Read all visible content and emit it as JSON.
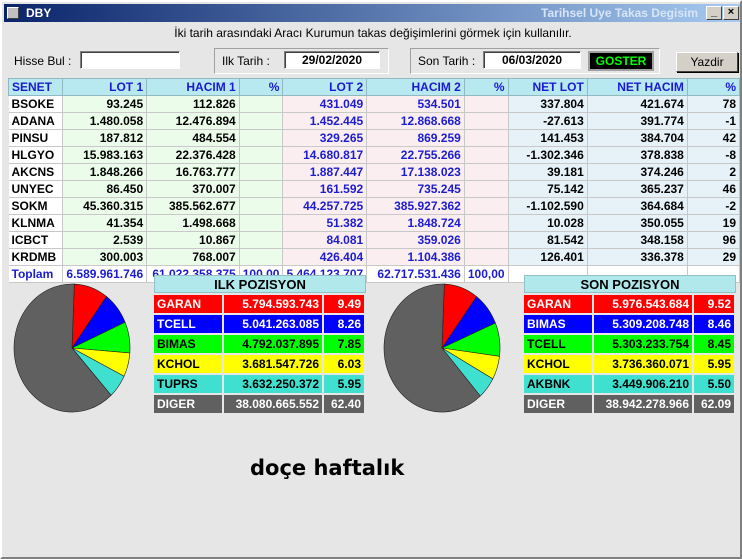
{
  "window": {
    "title": "DBY",
    "title_right": "Tarihsel Uye Takas Degisim",
    "min_label": "_",
    "max_label": "□",
    "close_label": "×"
  },
  "info": "İki tarih arasındaki  Aracı Kurumun takas değişimlerini görmek için kullanılır.",
  "toolbar": {
    "hisse_label": "Hisse Bul :",
    "hisse_value": "",
    "ilk_label": "Ilk Tarih :",
    "ilk_value": "29/02/2020",
    "son_label": "Son Tarih :",
    "son_value": "06/03/2020",
    "goster_label": "GOSTER",
    "yazdir_label": "Yazdir"
  },
  "table": {
    "headers": [
      "SENET",
      "LOT 1",
      "HACIM 1",
      "%",
      "LOT 2",
      "HACIM 2",
      "%",
      "NET LOT",
      "NET HACIM",
      "%"
    ],
    "rows": [
      [
        "BSOKE",
        "93.245",
        "112.826",
        "",
        "431.049",
        "534.501",
        "",
        "337.804",
        "421.674",
        "78"
      ],
      [
        "ADANA",
        "1.480.058",
        "12.476.894",
        "",
        "1.452.445",
        "12.868.668",
        "",
        "-27.613",
        "391.774",
        "-1"
      ],
      [
        "PINSU",
        "187.812",
        "484.554",
        "",
        "329.265",
        "869.259",
        "",
        "141.453",
        "384.704",
        "42"
      ],
      [
        "HLGYO",
        "15.983.163",
        "22.376.428",
        "",
        "14.680.817",
        "22.755.266",
        "",
        "-1.302.346",
        "378.838",
        "-8"
      ],
      [
        "AKCNS",
        "1.848.266",
        "16.763.777",
        "",
        "1.887.447",
        "17.138.023",
        "",
        "39.181",
        "374.246",
        "2"
      ],
      [
        "UNYEC",
        "86.450",
        "370.007",
        "",
        "161.592",
        "735.245",
        "",
        "75.142",
        "365.237",
        "46"
      ],
      [
        "SOKM",
        "45.360.315",
        "385.562.677",
        "",
        "44.257.725",
        "385.927.362",
        "",
        "-1.102.590",
        "364.684",
        "-2"
      ],
      [
        "KLNMA",
        "41.354",
        "1.498.668",
        "",
        "51.382",
        "1.848.724",
        "",
        "10.028",
        "350.055",
        "19"
      ],
      [
        "ICBCT",
        "2.539",
        "10.867",
        "",
        "84.081",
        "359.026",
        "",
        "81.542",
        "348.158",
        "96"
      ],
      [
        "KRDMB",
        "300.003",
        "768.007",
        "",
        "426.404",
        "1.104.386",
        "",
        "126.401",
        "336.378",
        "29"
      ]
    ],
    "total": [
      "Toplam",
      "6.589.961.746",
      "61.022.358.375",
      "100,00",
      "5.464.123.707",
      "62.717.531.436",
      "100,00",
      "",
      "",
      ""
    ]
  },
  "ilk": {
    "title": "ILK POZISYON",
    "items": [
      {
        "name": "GARAN",
        "value": "5.794.593.743",
        "pct": "9.49",
        "pct_num": 9.49,
        "bg": "#ff0000",
        "fg": "#ffffff"
      },
      {
        "name": "TCELL",
        "value": "5.041.263.085",
        "pct": "8.26",
        "pct_num": 8.26,
        "bg": "#0000ff",
        "fg": "#ffffff"
      },
      {
        "name": "BIMAS",
        "value": "4.792.037.895",
        "pct": "7.85",
        "pct_num": 7.85,
        "bg": "#00ff00",
        "fg": "#000000"
      },
      {
        "name": "KCHOL",
        "value": "3.681.547.726",
        "pct": "6.03",
        "pct_num": 6.03,
        "bg": "#ffff00",
        "fg": "#000000"
      },
      {
        "name": "TUPRS",
        "value": "3.632.250.372",
        "pct": "5.95",
        "pct_num": 5.95,
        "bg": "#40e0d0",
        "fg": "#000000"
      },
      {
        "name": "DIGER",
        "value": "38.080.665.552",
        "pct": "62.40",
        "pct_num": 62.4,
        "bg": "#606060",
        "fg": "#ffffff"
      }
    ]
  },
  "son": {
    "title": "SON POZISYON",
    "items": [
      {
        "name": "GARAN",
        "value": "5.976.543.684",
        "pct": "9.52",
        "pct_num": 9.52,
        "bg": "#ff0000",
        "fg": "#ffffff"
      },
      {
        "name": "BIMAS",
        "value": "5.309.208.748",
        "pct": "8.46",
        "pct_num": 8.46,
        "bg": "#0000ff",
        "fg": "#ffffff"
      },
      {
        "name": "TCELL",
        "value": "5.303.233.754",
        "pct": "8.45",
        "pct_num": 8.45,
        "bg": "#00ff00",
        "fg": "#000000"
      },
      {
        "name": "KCHOL",
        "value": "3.736.360.071",
        "pct": "5.95",
        "pct_num": 5.95,
        "bg": "#ffff00",
        "fg": "#000000"
      },
      {
        "name": "AKBNK",
        "value": "3.449.906.210",
        "pct": "5.50",
        "pct_num": 5.5,
        "bg": "#40e0d0",
        "fg": "#000000"
      },
      {
        "name": "DIGER",
        "value": "38.942.278.966",
        "pct": "62.09",
        "pct_num": 62.09,
        "bg": "#606060",
        "fg": "#ffffff"
      }
    ]
  },
  "caption": "doçe haftalık"
}
